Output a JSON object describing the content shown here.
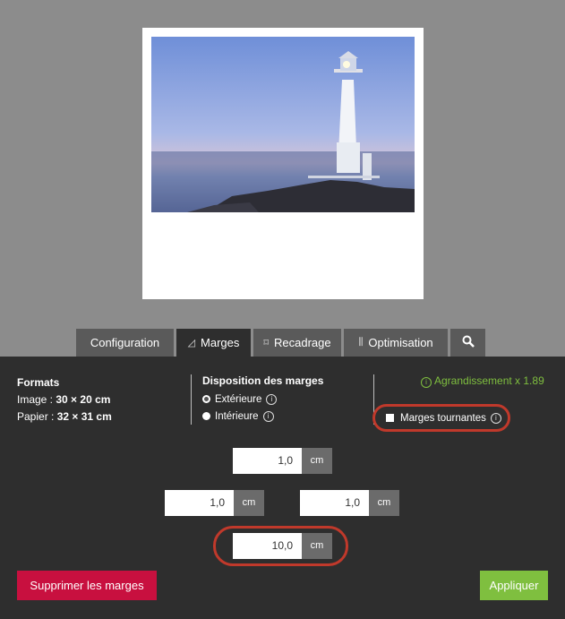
{
  "tabs": [
    {
      "label": "Configuration",
      "icon": ""
    },
    {
      "label": "Marges",
      "icon": "margin-icon"
    },
    {
      "label": "Recadrage",
      "icon": "crop-icon"
    },
    {
      "label": "Optimisation",
      "icon": "sliders-icon"
    },
    {
      "label": "",
      "icon": "magnifier-icon"
    }
  ],
  "formats": {
    "title": "Formats",
    "image_label": "Image :",
    "image_value": "30 × 20 cm",
    "paper_label": "Papier :",
    "paper_value": "32 × 31 cm"
  },
  "disposition": {
    "title": "Disposition des marges",
    "options": [
      "Extérieure",
      "Intérieure"
    ],
    "selected": "Extérieure"
  },
  "enlargement": "Agrandissement x 1.89",
  "rotating_margins_label": "Marges tournantes",
  "margins": {
    "top": "1,0",
    "left": "1,0",
    "right": "1,0",
    "bottom": "10,0",
    "unit": "cm"
  },
  "buttons": {
    "delete": "Supprimer les marges",
    "apply": "Appliquer"
  },
  "colors": {
    "accent_green": "#7fbf3f",
    "delete_red": "#c8103f",
    "highlight_red": "#c0392b"
  }
}
